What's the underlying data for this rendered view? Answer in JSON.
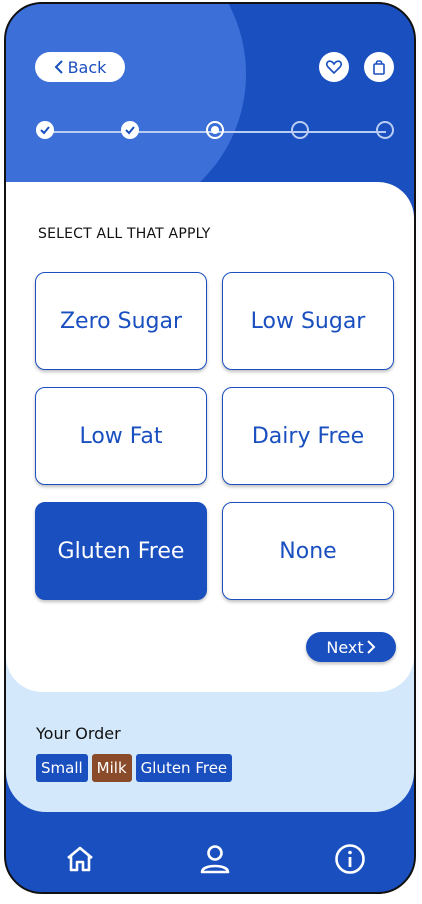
{
  "header": {
    "back_label": "Back",
    "icons": [
      "chevron-left-icon",
      "heart-icon",
      "shopping-bag-icon"
    ]
  },
  "progress": {
    "total_steps": 5,
    "current_step": 3,
    "completed_steps": 2
  },
  "question": {
    "prompt": "SELECT ALL THAT APPLY",
    "options": [
      {
        "label": "Zero Sugar",
        "selected": false
      },
      {
        "label": "Low Sugar",
        "selected": false
      },
      {
        "label": "Low Fat",
        "selected": false
      },
      {
        "label": "Dairy Free",
        "selected": false
      },
      {
        "label": "Gluten Free",
        "selected": true
      },
      {
        "label": "None",
        "selected": false
      }
    ],
    "next_label": "Next"
  },
  "order": {
    "title": "Your Order",
    "tags": [
      "Small",
      "Milk",
      "Gluten Free"
    ]
  },
  "nav": {
    "items": [
      "home-icon",
      "user-icon",
      "info-icon"
    ]
  },
  "colors": {
    "primary": "#1a4fbf",
    "light_panel": "#d3e8fb",
    "milk_tag": "#8a4b2a"
  }
}
